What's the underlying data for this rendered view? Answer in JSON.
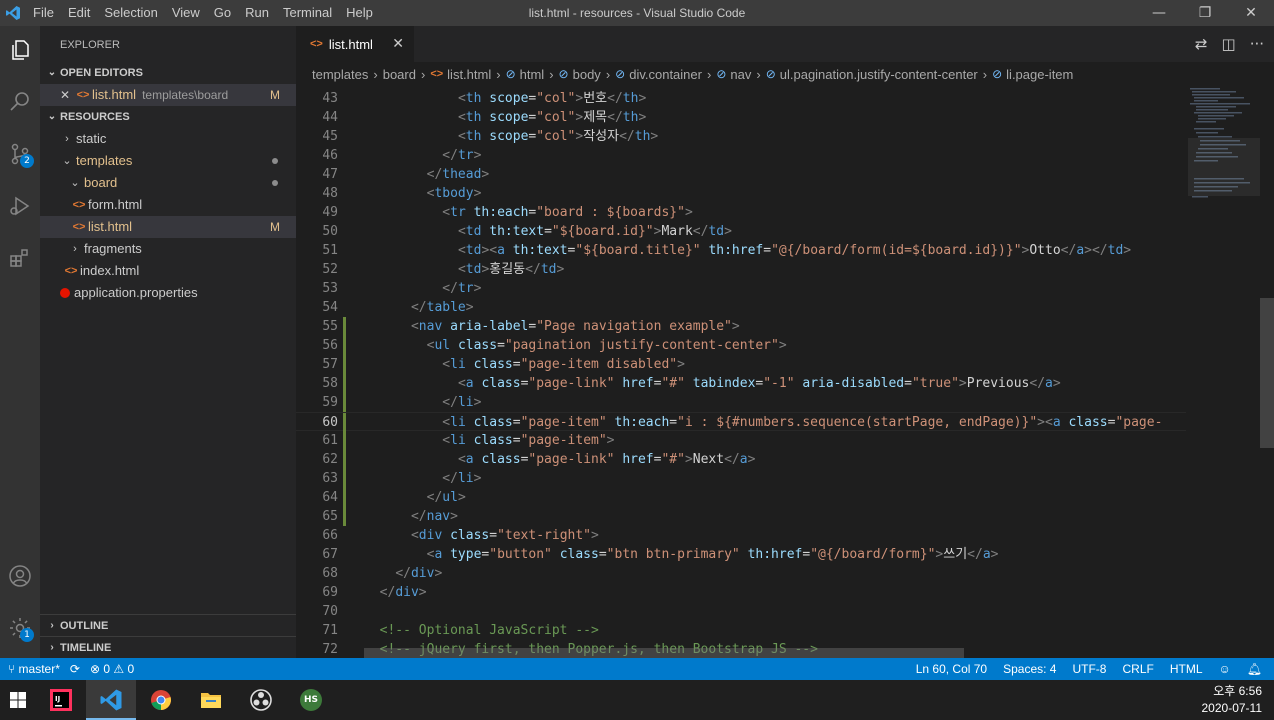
{
  "window": {
    "title": "list.html - resources - Visual Studio Code",
    "menu": [
      "File",
      "Edit",
      "Selection",
      "View",
      "Go",
      "Run",
      "Terminal",
      "Help"
    ],
    "controls": {
      "minimize": "—",
      "maximize": "❐",
      "close": "✕"
    }
  },
  "activitybar": {
    "scm_badge": "2",
    "settings_badge": "1"
  },
  "sidebar": {
    "title": "EXPLORER",
    "open_editors": {
      "header": "OPEN EDITORS",
      "items": [
        {
          "name": "list.html",
          "path": "templates\\board",
          "badge": "M"
        }
      ]
    },
    "resources": {
      "header": "RESOURCES",
      "static": "static",
      "templates": "templates",
      "board": "board",
      "form": "form.html",
      "list": "list.html",
      "list_badge": "M",
      "fragments": "fragments",
      "index": "index.html",
      "application": "application.properties"
    },
    "outline": "OUTLINE",
    "timeline": "TIMELINE"
  },
  "tab": {
    "label": "list.html",
    "close": "✕"
  },
  "breadcrumb": [
    "templates",
    "board",
    "list.html",
    "html",
    "body",
    "div.container",
    "nav",
    "ul.pagination.justify-content-center",
    "li.page-item"
  ],
  "editor": {
    "lines": [
      {
        "n": "43",
        "indent": 12,
        "tokens": [
          [
            "br",
            "<"
          ],
          [
            "tag",
            "th"
          ],
          [
            "txt",
            " "
          ],
          [
            "attr",
            "scope"
          ],
          [
            "txt",
            "="
          ],
          [
            "str",
            "\"col\""
          ],
          [
            "br",
            ">"
          ],
          [
            "txt",
            "번호"
          ],
          [
            "br",
            "</"
          ],
          [
            "tag",
            "th"
          ],
          [
            "br",
            ">"
          ]
        ]
      },
      {
        "n": "44",
        "indent": 12,
        "tokens": [
          [
            "br",
            "<"
          ],
          [
            "tag",
            "th"
          ],
          [
            "txt",
            " "
          ],
          [
            "attr",
            "scope"
          ],
          [
            "txt",
            "="
          ],
          [
            "str",
            "\"col\""
          ],
          [
            "br",
            ">"
          ],
          [
            "txt",
            "제목"
          ],
          [
            "br",
            "</"
          ],
          [
            "tag",
            "th"
          ],
          [
            "br",
            ">"
          ]
        ]
      },
      {
        "n": "45",
        "indent": 12,
        "tokens": [
          [
            "br",
            "<"
          ],
          [
            "tag",
            "th"
          ],
          [
            "txt",
            " "
          ],
          [
            "attr",
            "scope"
          ],
          [
            "txt",
            "="
          ],
          [
            "str",
            "\"col\""
          ],
          [
            "br",
            ">"
          ],
          [
            "txt",
            "작성자"
          ],
          [
            "br",
            "</"
          ],
          [
            "tag",
            "th"
          ],
          [
            "br",
            ">"
          ]
        ]
      },
      {
        "n": "46",
        "indent": 10,
        "tokens": [
          [
            "br",
            "</"
          ],
          [
            "tag",
            "tr"
          ],
          [
            "br",
            ">"
          ]
        ]
      },
      {
        "n": "47",
        "indent": 8,
        "tokens": [
          [
            "br",
            "</"
          ],
          [
            "tag",
            "thead"
          ],
          [
            "br",
            ">"
          ]
        ]
      },
      {
        "n": "48",
        "indent": 8,
        "tokens": [
          [
            "br",
            "<"
          ],
          [
            "tag",
            "tbody"
          ],
          [
            "br",
            ">"
          ]
        ]
      },
      {
        "n": "49",
        "indent": 10,
        "tokens": [
          [
            "br",
            "<"
          ],
          [
            "tag",
            "tr"
          ],
          [
            "txt",
            " "
          ],
          [
            "attr",
            "th:each"
          ],
          [
            "txt",
            "="
          ],
          [
            "str",
            "\"board : ${boards}\""
          ],
          [
            "br",
            ">"
          ]
        ]
      },
      {
        "n": "50",
        "indent": 12,
        "tokens": [
          [
            "br",
            "<"
          ],
          [
            "tag",
            "td"
          ],
          [
            "txt",
            " "
          ],
          [
            "attr",
            "th:text"
          ],
          [
            "txt",
            "="
          ],
          [
            "str",
            "\"${board.id}\""
          ],
          [
            "br",
            ">"
          ],
          [
            "txt",
            "Mark"
          ],
          [
            "br",
            "</"
          ],
          [
            "tag",
            "td"
          ],
          [
            "br",
            ">"
          ]
        ]
      },
      {
        "n": "51",
        "indent": 12,
        "tokens": [
          [
            "br",
            "<"
          ],
          [
            "tag",
            "td"
          ],
          [
            "br",
            "><"
          ],
          [
            "tag",
            "a"
          ],
          [
            "txt",
            " "
          ],
          [
            "attr",
            "th:text"
          ],
          [
            "txt",
            "="
          ],
          [
            "str",
            "\"${board.title}\""
          ],
          [
            "txt",
            " "
          ],
          [
            "attr",
            "th:href"
          ],
          [
            "txt",
            "="
          ],
          [
            "str",
            "\"@{/board/form(id=${board.id})}\""
          ],
          [
            "br",
            ">"
          ],
          [
            "txt",
            "Otto"
          ],
          [
            "br",
            "</"
          ],
          [
            "tag",
            "a"
          ],
          [
            "br",
            "></"
          ],
          [
            "tag",
            "td"
          ],
          [
            "br",
            ">"
          ]
        ]
      },
      {
        "n": "52",
        "indent": 12,
        "tokens": [
          [
            "br",
            "<"
          ],
          [
            "tag",
            "td"
          ],
          [
            "br",
            ">"
          ],
          [
            "txt",
            "홍길동"
          ],
          [
            "br",
            "</"
          ],
          [
            "tag",
            "td"
          ],
          [
            "br",
            ">"
          ]
        ]
      },
      {
        "n": "53",
        "indent": 10,
        "tokens": [
          [
            "br",
            "</"
          ],
          [
            "tag",
            "tr"
          ],
          [
            "br",
            ">"
          ]
        ]
      },
      {
        "n": "54",
        "indent": 6,
        "tokens": [
          [
            "br",
            "</"
          ],
          [
            "tag",
            "table"
          ],
          [
            "br",
            ">"
          ]
        ]
      },
      {
        "n": "55",
        "indent": 6,
        "tokens": [
          [
            "br",
            "<"
          ],
          [
            "tag",
            "nav"
          ],
          [
            "txt",
            " "
          ],
          [
            "attr",
            "aria-label"
          ],
          [
            "txt",
            "="
          ],
          [
            "str",
            "\"Page navigation example\""
          ],
          [
            "br",
            ">"
          ]
        ]
      },
      {
        "n": "56",
        "indent": 8,
        "tokens": [
          [
            "br",
            "<"
          ],
          [
            "tag",
            "ul"
          ],
          [
            "txt",
            " "
          ],
          [
            "attr",
            "class"
          ],
          [
            "txt",
            "="
          ],
          [
            "str",
            "\"pagination justify-content-center\""
          ],
          [
            "br",
            ">"
          ]
        ]
      },
      {
        "n": "57",
        "indent": 10,
        "tokens": [
          [
            "br",
            "<"
          ],
          [
            "tag",
            "li"
          ],
          [
            "txt",
            " "
          ],
          [
            "attr",
            "class"
          ],
          [
            "txt",
            "="
          ],
          [
            "str",
            "\"page-item disabled\""
          ],
          [
            "br",
            ">"
          ]
        ]
      },
      {
        "n": "58",
        "indent": 12,
        "tokens": [
          [
            "br",
            "<"
          ],
          [
            "tag",
            "a"
          ],
          [
            "txt",
            " "
          ],
          [
            "attr",
            "class"
          ],
          [
            "txt",
            "="
          ],
          [
            "str",
            "\"page-link\""
          ],
          [
            "txt",
            " "
          ],
          [
            "attr",
            "href"
          ],
          [
            "txt",
            "="
          ],
          [
            "str",
            "\"#\""
          ],
          [
            "txt",
            " "
          ],
          [
            "attr",
            "tabindex"
          ],
          [
            "txt",
            "="
          ],
          [
            "str",
            "\"-1\""
          ],
          [
            "txt",
            " "
          ],
          [
            "attr",
            "aria-disabled"
          ],
          [
            "txt",
            "="
          ],
          [
            "str",
            "\"true\""
          ],
          [
            "br",
            ">"
          ],
          [
            "txt",
            "Previous"
          ],
          [
            "br",
            "</"
          ],
          [
            "tag",
            "a"
          ],
          [
            "br",
            ">"
          ]
        ]
      },
      {
        "n": "59",
        "indent": 10,
        "tokens": [
          [
            "br",
            "</"
          ],
          [
            "tag",
            "li"
          ],
          [
            "br",
            ">"
          ]
        ]
      },
      {
        "n": "60",
        "indent": 10,
        "tokens": [
          [
            "br",
            "<"
          ],
          [
            "tag",
            "li"
          ],
          [
            "txt",
            " "
          ],
          [
            "attr",
            "class"
          ],
          [
            "txt",
            "="
          ],
          [
            "str",
            "\"page-item\""
          ],
          [
            "txt",
            " "
          ],
          [
            "attr",
            "th:each"
          ],
          [
            "txt",
            "="
          ],
          [
            "str",
            "\"i : ${#numbers.sequence(startPage, endPage)}\""
          ],
          [
            "br",
            ">"
          ],
          [
            "br",
            "<"
          ],
          [
            "tag",
            "a"
          ],
          [
            "txt",
            " "
          ],
          [
            "attr",
            "class"
          ],
          [
            "txt",
            "="
          ],
          [
            "str",
            "\"page-"
          ]
        ]
      },
      {
        "n": "61",
        "indent": 10,
        "tokens": [
          [
            "br",
            "<"
          ],
          [
            "tag",
            "li"
          ],
          [
            "txt",
            " "
          ],
          [
            "attr",
            "class"
          ],
          [
            "txt",
            "="
          ],
          [
            "str",
            "\"page-item\""
          ],
          [
            "br",
            ">"
          ]
        ]
      },
      {
        "n": "62",
        "indent": 12,
        "tokens": [
          [
            "br",
            "<"
          ],
          [
            "tag",
            "a"
          ],
          [
            "txt",
            " "
          ],
          [
            "attr",
            "class"
          ],
          [
            "txt",
            "="
          ],
          [
            "str",
            "\"page-link\""
          ],
          [
            "txt",
            " "
          ],
          [
            "attr",
            "href"
          ],
          [
            "txt",
            "="
          ],
          [
            "str",
            "\"#\""
          ],
          [
            "br",
            ">"
          ],
          [
            "txt",
            "Next"
          ],
          [
            "br",
            "</"
          ],
          [
            "tag",
            "a"
          ],
          [
            "br",
            ">"
          ]
        ]
      },
      {
        "n": "63",
        "indent": 10,
        "tokens": [
          [
            "br",
            "</"
          ],
          [
            "tag",
            "li"
          ],
          [
            "br",
            ">"
          ]
        ]
      },
      {
        "n": "64",
        "indent": 8,
        "tokens": [
          [
            "br",
            "</"
          ],
          [
            "tag",
            "ul"
          ],
          [
            "br",
            ">"
          ]
        ]
      },
      {
        "n": "65",
        "indent": 6,
        "tokens": [
          [
            "br",
            "</"
          ],
          [
            "tag",
            "nav"
          ],
          [
            "br",
            ">"
          ]
        ]
      },
      {
        "n": "66",
        "indent": 6,
        "tokens": [
          [
            "br",
            "<"
          ],
          [
            "tag",
            "div"
          ],
          [
            "txt",
            " "
          ],
          [
            "attr",
            "class"
          ],
          [
            "txt",
            "="
          ],
          [
            "str",
            "\"text-right\""
          ],
          [
            "br",
            ">"
          ]
        ]
      },
      {
        "n": "67",
        "indent": 8,
        "tokens": [
          [
            "br",
            "<"
          ],
          [
            "tag",
            "a"
          ],
          [
            "txt",
            " "
          ],
          [
            "attr",
            "type"
          ],
          [
            "txt",
            "="
          ],
          [
            "str",
            "\"button\""
          ],
          [
            "txt",
            " "
          ],
          [
            "attr",
            "class"
          ],
          [
            "txt",
            "="
          ],
          [
            "str",
            "\"btn btn-primary\""
          ],
          [
            "txt",
            " "
          ],
          [
            "attr",
            "th:href"
          ],
          [
            "txt",
            "="
          ],
          [
            "str",
            "\"@{/board/form}\""
          ],
          [
            "br",
            ">"
          ],
          [
            "txt",
            "쓰기"
          ],
          [
            "br",
            "</"
          ],
          [
            "tag",
            "a"
          ],
          [
            "br",
            ">"
          ]
        ]
      },
      {
        "n": "68",
        "indent": 4,
        "tokens": [
          [
            "br",
            "</"
          ],
          [
            "tag",
            "div"
          ],
          [
            "br",
            ">"
          ]
        ]
      },
      {
        "n": "69",
        "indent": 2,
        "tokens": [
          [
            "br",
            "</"
          ],
          [
            "tag",
            "div"
          ],
          [
            "br",
            ">"
          ]
        ]
      },
      {
        "n": "70",
        "indent": 0,
        "tokens": []
      },
      {
        "n": "71",
        "indent": 2,
        "tokens": [
          [
            "com",
            "<!-- Optional JavaScript -->"
          ]
        ]
      },
      {
        "n": "72",
        "indent": 2,
        "tokens": [
          [
            "com",
            "<!-- jQuery first, then Popper.js, then Bootstrap JS -->"
          ]
        ]
      }
    ],
    "current_line": "60"
  },
  "statusbar": {
    "branch": "master*",
    "errors": "0",
    "warnings": "0",
    "position": "Ln 60, Col 70",
    "spaces": "Spaces: 4",
    "encoding": "UTF-8",
    "eol": "CRLF",
    "language": "HTML"
  },
  "taskbar": {
    "hs_label": "HS",
    "time": "오후 6:56",
    "date": "2020-07-11"
  },
  "colors": {
    "accent": "#007acc",
    "titlebar": "#3c3c3c",
    "sidebar": "#252526",
    "editor": "#1e1e1e"
  }
}
